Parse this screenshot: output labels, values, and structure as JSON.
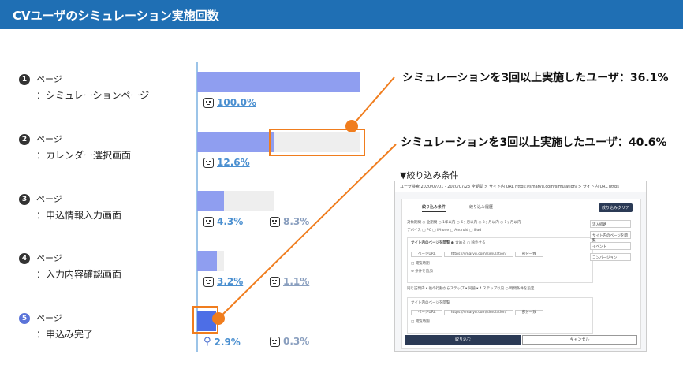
{
  "title": "CVユーザのシミュレーション実施回数",
  "steps": [
    {
      "num": "1",
      "label": "ページ",
      "name": "：シミュレーションページ",
      "pct1": "100.0%",
      "pct1_fill": 1.0
    },
    {
      "num": "2",
      "label": "ページ",
      "name": "：カレンダー選択画面",
      "pct1": "12.6%",
      "pct1_fill": 0.126
    },
    {
      "num": "3",
      "label": "ページ",
      "name": "：申込情報入力画面",
      "pct1": "4.3%",
      "pct2": "8.3%",
      "pct1_fill": 0.043,
      "pct2_fill": 0.083
    },
    {
      "num": "4",
      "label": "ページ",
      "name": "：入力内容確認画面",
      "pct1": "3.2%",
      "pct2": "1.1%",
      "pct1_fill": 0.032,
      "pct2_fill": 0.011
    },
    {
      "num": "5",
      "label": "ページ",
      "name": "：申込み完了",
      "pct1": "2.9%",
      "pct2": "0.3%",
      "pct1_fill": 0.029
    }
  ],
  "callouts": {
    "top": "シミュレーションを3回以上実施したユーザ：36.1%",
    "bottom": "シミュレーションを3回以上実施したユーザ：40.6%"
  },
  "condition_label": "▼絞り込み条件",
  "screenshot": {
    "top_bar": "ユーザ検索  2020/07/01 - 2020/07/23     全期間 > サイト内 URL https://smaryu.com/simulation/ > サイト内 URL https",
    "tabs": [
      "絞り込み条件",
      "絞り込み履歴"
    ],
    "clear_button": "絞り込みクリア",
    "target_row": "対象期間  ○ 全期間  ○ 1年以内  ○ 6ヶ月以内  ○ 3ヶ月以内  ○ 1ヶ月以内",
    "device_row": "デバイス  □ PC  □ iPhone  □ Android  □ iPad",
    "section_title": "サイト内のページを閲覧",
    "section_options": "● 含める  ○ 除外する",
    "url_dropdown": "ページURL",
    "url_value": "https://smaryu.com/simulation/",
    "match_dropdown": "部分一致",
    "period_check": "□ 閲覧時期",
    "add_condition": "⊕ 条件を追加",
    "sequence_row": "同じ訪問内  ▾  後の行動からステップ ▾  同値 ▾  4  ステップ以内  ○ 時間条件を設定",
    "side_items": [
      "流入経路",
      "サイト内のページを閲覧",
      "イベント",
      "コンバージョン"
    ],
    "apply_button": "絞り込む",
    "cancel_button": "キャンセル"
  },
  "colors": {
    "header_bg": "#1f6fb4",
    "bar": "#8f9ef0",
    "bar_last": "#4d6ee6",
    "bar_bg": "#eeeeee",
    "callout_line": "#f07d1e",
    "pct_link": "#4a8fd0"
  }
}
